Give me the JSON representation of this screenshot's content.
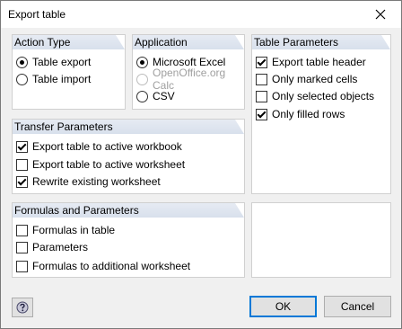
{
  "window": {
    "title": "Export table",
    "close_icon": "close-icon"
  },
  "action_type": {
    "heading": "Action Type",
    "options": [
      {
        "label": "Table export",
        "checked": true
      },
      {
        "label": "Table import",
        "checked": false
      }
    ]
  },
  "application": {
    "heading": "Application",
    "options": [
      {
        "label": "Microsoft Excel",
        "checked": true,
        "enabled": true
      },
      {
        "label": "OpenOffice.org Calc",
        "checked": false,
        "enabled": false
      },
      {
        "label": "CSV",
        "checked": false,
        "enabled": true
      }
    ]
  },
  "table_parameters": {
    "heading": "Table Parameters",
    "options": [
      {
        "label": "Export table header",
        "checked": true
      },
      {
        "label": "Only marked cells",
        "checked": false
      },
      {
        "label": "Only selected objects",
        "checked": false
      },
      {
        "label": "Only filled rows",
        "checked": true
      }
    ]
  },
  "transfer_parameters": {
    "heading": "Transfer Parameters",
    "options": [
      {
        "label": "Export table to active workbook",
        "checked": true
      },
      {
        "label": "Export table to active worksheet",
        "checked": false
      },
      {
        "label": "Rewrite existing worksheet",
        "checked": true
      }
    ]
  },
  "formulas": {
    "heading": "Formulas and Parameters",
    "options": [
      {
        "label": "Formulas in table",
        "checked": false
      },
      {
        "label": "Parameters",
        "checked": false
      },
      {
        "label": "Formulas to additional worksheet",
        "checked": false
      }
    ]
  },
  "footer": {
    "ok_label": "OK",
    "cancel_label": "Cancel",
    "help_icon": "help-icon"
  }
}
